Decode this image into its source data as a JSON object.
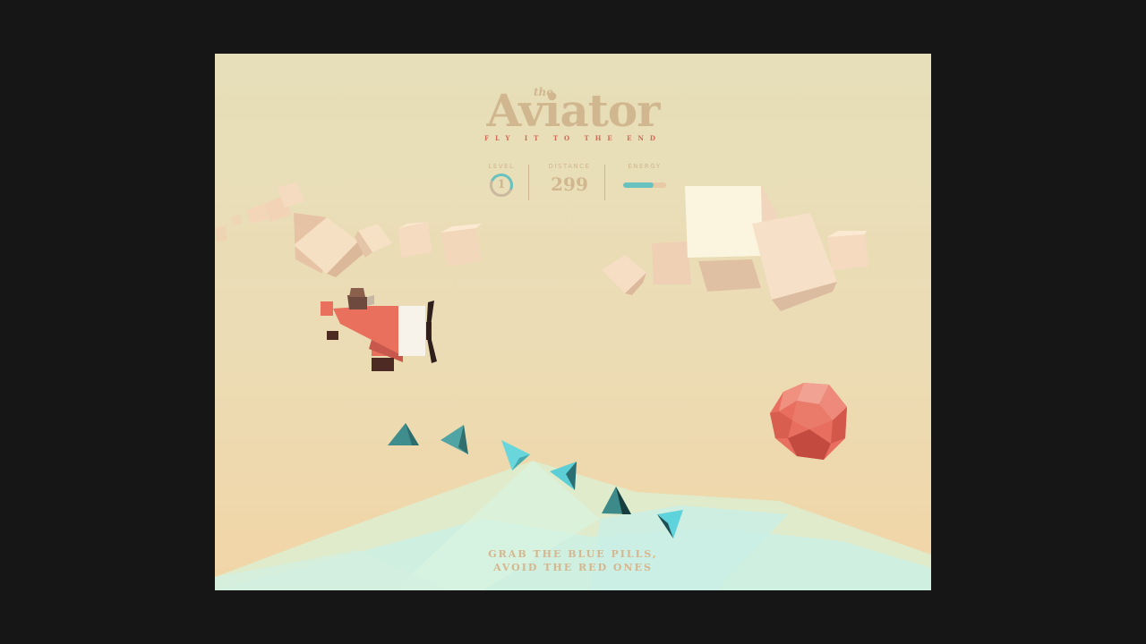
{
  "game": {
    "title_prefix": "the",
    "title": "Aviator",
    "subtitle": "FLY IT TO THE END"
  },
  "hud": {
    "level_label": "LEVEL",
    "level_value": "1",
    "level_progress": 0.3,
    "distance_label": "DISTANCE",
    "distance_value": "299",
    "energy_label": "ENERGY",
    "energy_level": 0.7
  },
  "instructions": {
    "line1": "GRAB THE BLUE PILLS,",
    "line2": "AVOID THE RED ONES"
  },
  "colors": {
    "sky_top": "#e6dfb9",
    "sky_bottom": "#f1d5a6",
    "title": "#d1b790",
    "subtitle": "#cf6a56",
    "plane_red": "#e8705c",
    "pill_blue": "#68c3c0",
    "enemy_red": "#e86f5f",
    "sea": "#cdf0e0"
  },
  "icons": {
    "plane": "airplane-icon",
    "pill": "blue-pill-icon",
    "enemy": "red-enemy-icon",
    "cloud": "cube-cloud-icon"
  }
}
